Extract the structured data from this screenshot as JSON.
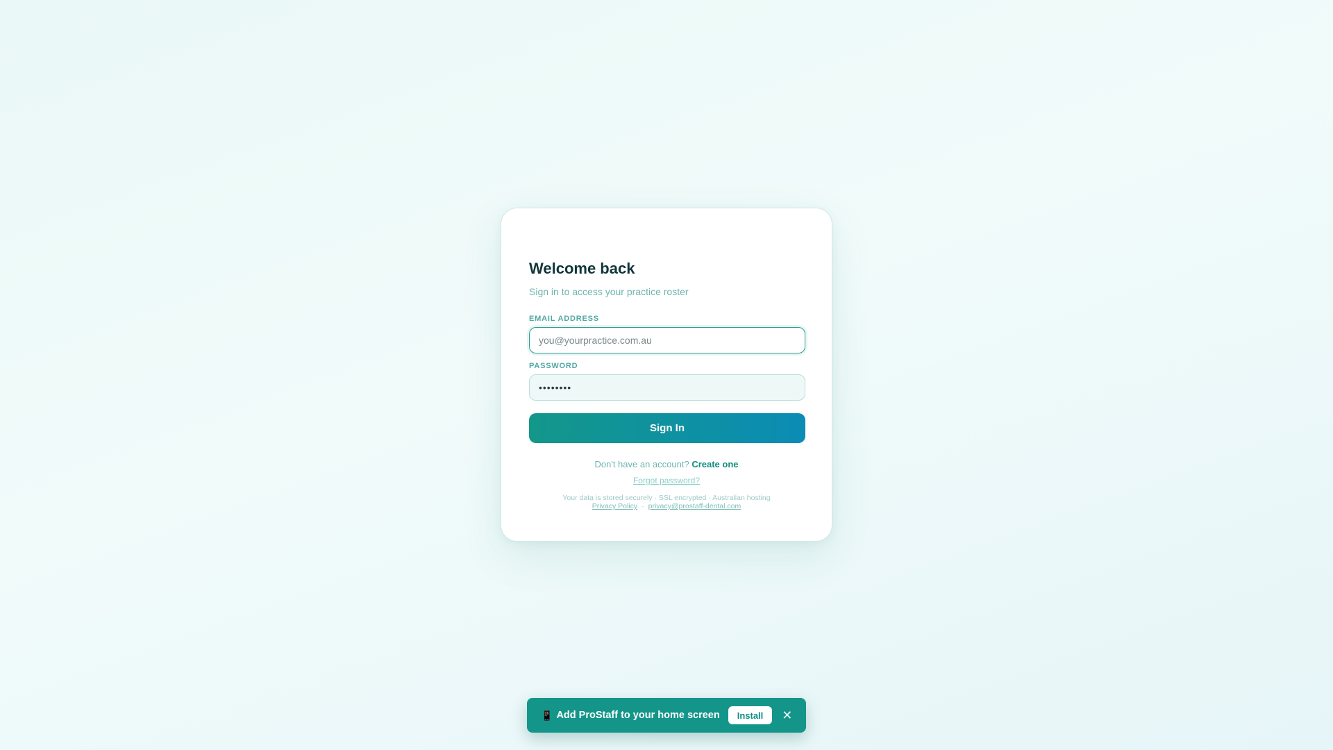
{
  "login": {
    "title": "Welcome back",
    "subtitle": "Sign in to access your practice roster",
    "email_label": "EMAIL ADDRESS",
    "email_placeholder": "you@yourpractice.com.au",
    "password_label": "PASSWORD",
    "password_value": "••••••••",
    "signin_label": "Sign In",
    "no_account_text": "Don't have an account?",
    "create_link": "Create one",
    "forgot_link": "Forgot password?",
    "security_note": "Your data is stored securely · SSL encrypted · Australian hosting",
    "privacy_link": "Privacy Policy",
    "separator": "·",
    "privacy_email": "privacy@prostaff-dental.com"
  },
  "install_banner": {
    "icon": "📱",
    "icon_name": "mobile-phone-icon",
    "text": "Add ProStaff to your home screen",
    "install_label": "Install",
    "close_symbol": "✕"
  },
  "colors": {
    "accent": "#14958a",
    "button_gradient_start": "#13978a",
    "button_gradient_end": "#0b8cb5",
    "title": "#12363a"
  }
}
